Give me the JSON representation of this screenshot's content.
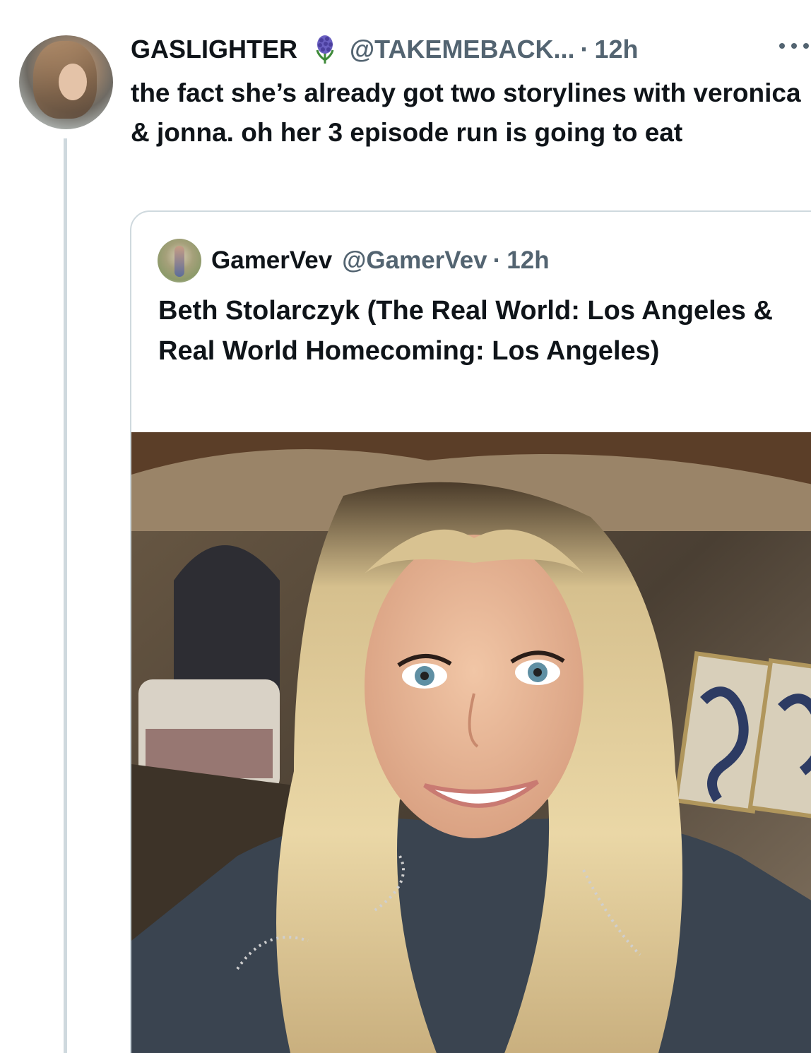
{
  "tweet": {
    "author_name": "GASLIGHTER",
    "author_emoji": "hyacinth-emoji",
    "handle": "@TAKEMEBACK...",
    "separator": "·",
    "time": "12h",
    "more_icon": "ellipsis-icon",
    "text": "the fact she’s already got two storylines with veronica & jonna. oh her 3 episode run is going to eat"
  },
  "quote": {
    "author_name": "GamerVev",
    "handle": "@GamerVev",
    "separator": "·",
    "time": "12h",
    "text": "Beth Stolarczyk (The Real World: Los Angeles & Real World Homecoming: Los Angeles)"
  },
  "colors": {
    "primary_text": "#0f1419",
    "secondary_text": "#536471",
    "border": "#cfd9de"
  }
}
